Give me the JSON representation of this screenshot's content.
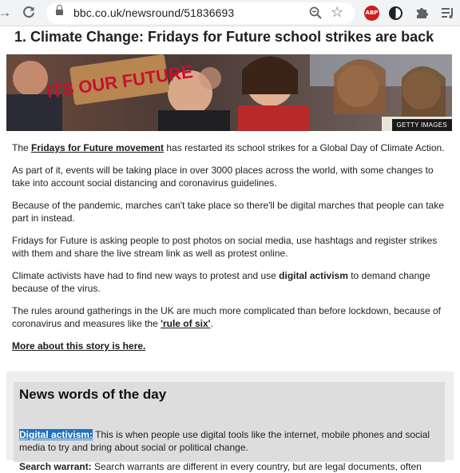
{
  "browser": {
    "url": "bbc.co.uk/newsround/51836693",
    "extensions": [
      "abp-icon",
      "half-circle-icon",
      "puzzle-icon",
      "queue-icon"
    ]
  },
  "article": {
    "title": "1. Climate Change: Fridays for Future school strikes are back",
    "image_credit": "GETTY IMAGES",
    "image_sign_text": "ITS OUR FUTURE",
    "p1_prefix": "The ",
    "p1_link": "Fridays for Future movement",
    "p1_suffix": " has restarted its school strikes for a Global Day of Climate Action.",
    "p2": "As part of it, events will be taking place in over 3000 places across the world, with some changes to take into account social distancing and coronavirus guidelines.",
    "p3": "Because of the pandemic, marches can't take place so there'll be digital marches that people can take part in instead.",
    "p4": "Fridays for Future is asking people to post photos on social media, use hashtags and register strikes with them and share the live stream link as well as protest online.",
    "p5_prefix": "Climate activists have had to find new ways to protest and use ",
    "p5_bold": "digital activism",
    "p5_suffix": " to demand change because of the virus.",
    "p6_prefix": "The rules around gatherings in the UK are much more complicated than before lockdown, because of coronavirus and measures like the ",
    "p6_link": "'rule of six'",
    "p6_suffix": ".",
    "more_link": "More about this story is here."
  },
  "words": {
    "title": "News words of the day",
    "term1": "Digital activism:",
    "def1": " This is when people use digital tools like the internet, mobile phones and social media to try and bring about social or political change.",
    "term2": "Search warrant:",
    "def2": " Search warrants are different in every country, but are legal documents, often"
  }
}
